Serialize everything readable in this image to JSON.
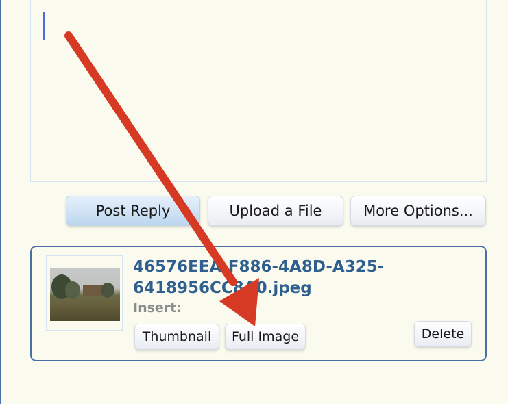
{
  "editor": {
    "content": ""
  },
  "actions": {
    "post_reply": "Post Reply",
    "upload_file": "Upload a File",
    "more_options": "More Options..."
  },
  "attachment": {
    "filename": "46576EEA-F886-4A8D-A325-6418956CC8A0.jpeg",
    "insert_label": "Insert:",
    "thumbnail_button": "Thumbnail",
    "full_image_button": "Full Image",
    "delete_button": "Delete"
  },
  "annotation": {
    "arrow_color": "#d63a25"
  }
}
